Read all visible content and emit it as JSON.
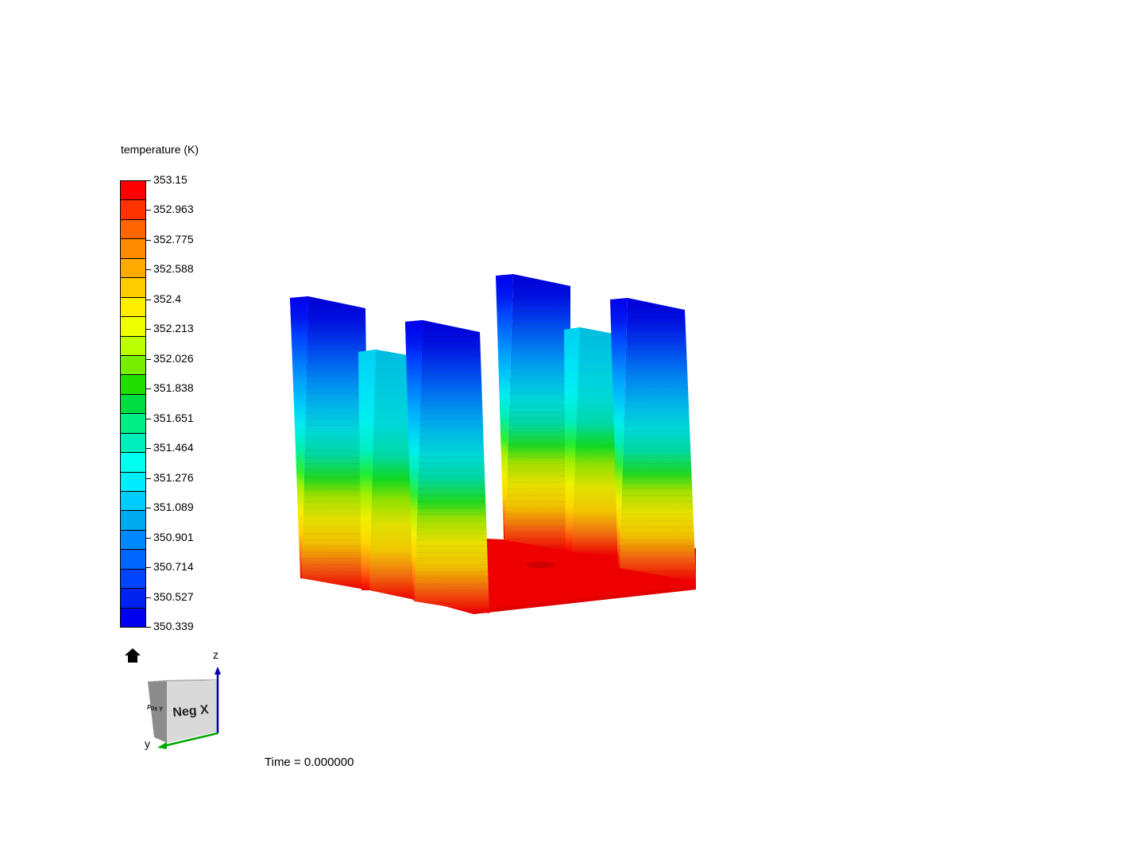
{
  "legend": {
    "title": "temperature (K)",
    "ticks": [
      "353.15",
      "352.963",
      "352.775",
      "352.588",
      "352.4",
      "352.213",
      "352.026",
      "351.838",
      "351.651",
      "351.464",
      "351.276",
      "351.089",
      "350.901",
      "350.714",
      "350.527",
      "350.339"
    ],
    "colors": [
      "#ff0000",
      "#ff3300",
      "#ff6600",
      "#ff8c00",
      "#ffaa00",
      "#ffcc00",
      "#ffee00",
      "#eeff00",
      "#bbff00",
      "#77ee00",
      "#22dd00",
      "#00dd44",
      "#00ee88",
      "#00eebb",
      "#00ffee",
      "#00eeff",
      "#00ccff",
      "#00aaee",
      "#0088ff",
      "#0066ff",
      "#0044ff",
      "#0022ee",
      "#0000ee"
    ]
  },
  "orientation_widget": {
    "face_front": "Neg X",
    "face_side": "Pos Y",
    "axis_z": "z",
    "axis_y": "y",
    "home_icon": "home-icon"
  },
  "time_label": "Time = 0.000000",
  "scene": {
    "description_icon": "heatsink-fins-temperature-contour"
  }
}
